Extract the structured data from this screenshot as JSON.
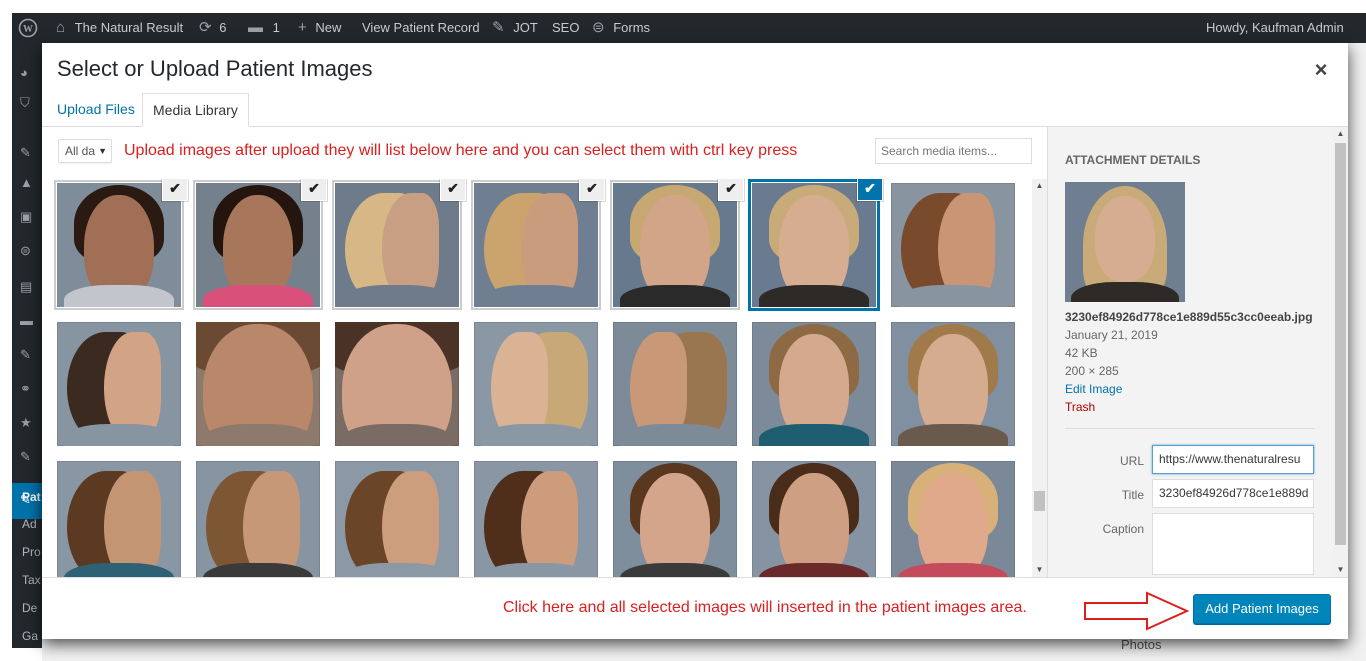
{
  "admin_bar": {
    "site_name": "The Natural Result",
    "updates_count": "6",
    "comments_count": "1",
    "new_label": "New",
    "view_record_label": "View Patient Record",
    "jot_label": "JOT",
    "seo_label": "SEO",
    "forms_label": "Forms",
    "howdy": "Howdy, Kaufman Admin"
  },
  "background_menu": [
    "Pat",
    "Ad",
    "Pro",
    "Tax",
    "De",
    "Ga"
  ],
  "background_footer": "Photos",
  "modal": {
    "title": "Select or Upload Patient Images",
    "close_symbol": "×",
    "tabs": [
      {
        "label": "Upload Files",
        "active": false
      },
      {
        "label": "Media Library",
        "active": true
      }
    ]
  },
  "browser": {
    "filter_value": "All da",
    "instruction": "Upload images after upload they will list below here and you can select them with ctrl key press",
    "search_placeholder": "Search media items..."
  },
  "attachments": [
    {
      "view": "front",
      "selected": true,
      "current": false,
      "skin": "#a06f55",
      "hair": "#2a1a12",
      "bg": "#7f8c9a",
      "top": "#c2c6cc"
    },
    {
      "view": "front",
      "selected": true,
      "current": false,
      "skin": "#a8765a",
      "hair": "#24160f",
      "bg": "#75808d",
      "top": "#d9507a"
    },
    {
      "view": "right",
      "selected": true,
      "current": false,
      "skin": "#c89f82",
      "hair": "#d6b785",
      "bg": "#6e7b8b",
      "top": "#6e7b8b"
    },
    {
      "view": "right",
      "selected": true,
      "current": false,
      "skin": "#c99c7e",
      "hair": "#caa46c",
      "bg": "#6f7e90",
      "top": "#6f7e90"
    },
    {
      "view": "front",
      "selected": true,
      "current": false,
      "skin": "#d2a488",
      "hair": "#c7a873",
      "bg": "#67798d",
      "top": "#2a2a2a"
    },
    {
      "view": "front",
      "selected": true,
      "current": true,
      "skin": "#d7ad92",
      "hair": "#c9ab79",
      "bg": "#6a7b8f",
      "top": "#2d2a28"
    },
    {
      "view": "right",
      "selected": false,
      "current": false,
      "skin": "#c99575",
      "hair": "#7a4a2c",
      "bg": "#8894a0",
      "top": "#8894a0"
    },
    {
      "view": "right",
      "selected": false,
      "current": false,
      "skin": "#d2a385",
      "hair": "#3b2a20",
      "bg": "#8795a3",
      "top": "#8795a3"
    },
    {
      "view": "close",
      "selected": false,
      "current": false,
      "skin": "#b9876a",
      "hair": "#6b4a33",
      "bg": "#8e7a6c",
      "top": "#8e7a6c"
    },
    {
      "view": "close",
      "selected": false,
      "current": false,
      "skin": "#cfa189",
      "hair": "#4a3326",
      "bg": "#7a6c64",
      "top": "#7a6c64"
    },
    {
      "view": "left",
      "selected": false,
      "current": false,
      "skin": "#d9b394",
      "hair": "#c9a878",
      "bg": "#8a97a5",
      "top": "#8a97a5"
    },
    {
      "view": "left",
      "selected": false,
      "current": false,
      "skin": "#c89877",
      "hair": "#9a7650",
      "bg": "#7d8a98",
      "top": "#7d8a98"
    },
    {
      "view": "front",
      "selected": false,
      "current": false,
      "skin": "#d4a98d",
      "hair": "#8d6a43",
      "bg": "#7c8a99",
      "top": "#1f5d70"
    },
    {
      "view": "front",
      "selected": false,
      "current": false,
      "skin": "#d6ac91",
      "hair": "#a07a4b",
      "bg": "#8190a0",
      "top": "#6a5a4c"
    },
    {
      "view": "right",
      "selected": false,
      "current": false,
      "skin": "#c49573",
      "hair": "#5c3a22",
      "bg": "#8996a4",
      "top": "#2f6175"
    },
    {
      "view": "right",
      "selected": false,
      "current": false,
      "skin": "#c79878",
      "hair": "#7d5634",
      "bg": "#8794a1",
      "top": "#3a3a3a"
    },
    {
      "view": "right",
      "selected": false,
      "current": false,
      "skin": "#cd9e7e",
      "hair": "#6b4528",
      "bg": "#8b98a6",
      "top": "#8b98a6"
    },
    {
      "view": "right",
      "selected": false,
      "current": false,
      "skin": "#cd9c7d",
      "hair": "#4f2e1a",
      "bg": "#8996a3",
      "top": "#8996a3"
    },
    {
      "view": "front",
      "selected": false,
      "current": false,
      "skin": "#d4a58a",
      "hair": "#5a3820",
      "bg": "#7f8e9d",
      "top": "#3a3a3a"
    },
    {
      "view": "front",
      "selected": false,
      "current": false,
      "skin": "#cf9f84",
      "hair": "#4a2c1a",
      "bg": "#8593a2",
      "top": "#6b2a2a"
    },
    {
      "view": "front",
      "selected": false,
      "current": false,
      "skin": "#e0a98c",
      "hair": "#d8b07a",
      "bg": "#7a8898",
      "top": "#c44b5b"
    }
  ],
  "details": {
    "heading": "Attachment Details",
    "filename": "3230ef84926d778ce1e889d55c3cc0eeab.jpg",
    "date": "January 21, 2019",
    "size": "42 KB",
    "dimensions": "200 × 285",
    "edit_label": "Edit Image",
    "trash_label": "Trash",
    "url_label": "URL",
    "url_value": "https://www.thenaturalresu",
    "title_label": "Title",
    "title_value": "3230ef84926d778ce1e889d",
    "caption_label": "Caption",
    "caption_value": ""
  },
  "toolbar": {
    "note": "Click here and all selected images will inserted in the patient images area.",
    "button_label": "Add Patient Images"
  },
  "colors": {
    "accent": "#0073aa",
    "annotation": "#dc1e1e",
    "primary_button": "#0085ba",
    "admin_bar": "#23282d"
  }
}
